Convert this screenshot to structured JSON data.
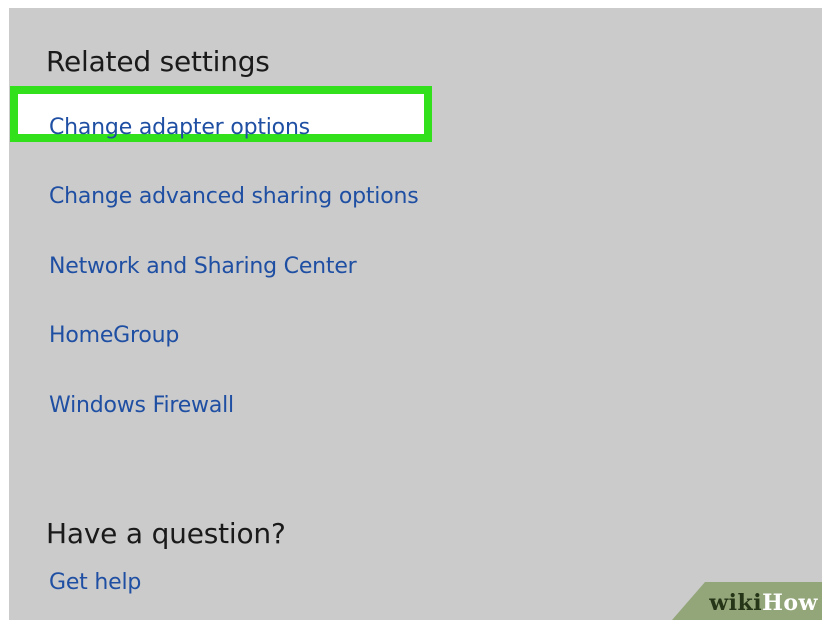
{
  "related_settings": {
    "heading": "Related settings",
    "links": [
      "Change adapter options",
      "Change advanced sharing options",
      "Network and Sharing Center",
      "HomeGroup",
      "Windows Firewall"
    ]
  },
  "question": {
    "heading": "Have a question?",
    "help_link": "Get help"
  },
  "watermark": {
    "part1": "wiki",
    "part2": "How"
  },
  "colors": {
    "background": "#cbcbcb",
    "link": "#1f4fa3",
    "highlight_border": "#33e01c",
    "watermark_bg": "#93a679"
  }
}
